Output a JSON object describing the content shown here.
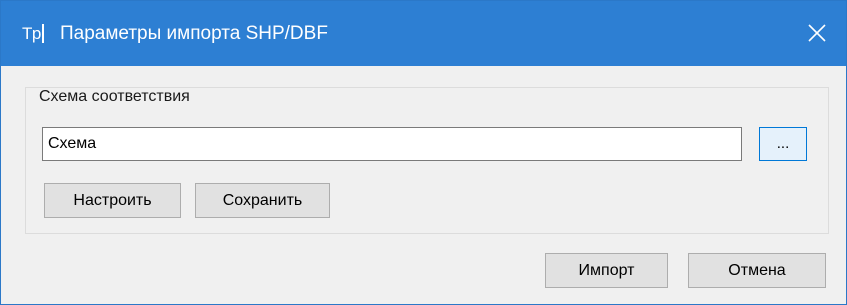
{
  "window": {
    "title": "Параметры импорта SHP/DBF",
    "app_icon_text": "Tp",
    "accent_color": "#2d7fd3"
  },
  "icons": {
    "app": "tp-app-icon",
    "close": "close-icon"
  },
  "group": {
    "label": "Схема соответствия",
    "schema_value": "Схема",
    "browse_label": "...",
    "configure_label": "Настроить",
    "save_label": "Сохранить"
  },
  "footer": {
    "import_label": "Импорт",
    "cancel_label": "Отмена"
  }
}
